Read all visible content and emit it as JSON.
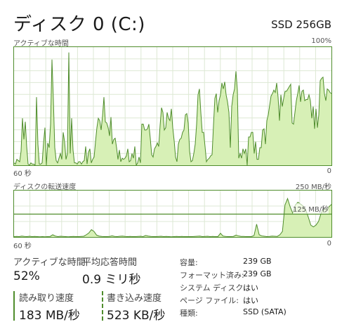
{
  "header": {
    "title": "ディスク 0 (C:)",
    "model": "SSD 256GB"
  },
  "active_chart": {
    "label": "アクティブな時間",
    "max_label": "100%",
    "time_label": "60 秒",
    "min_label": "0"
  },
  "transfer_chart": {
    "label": "ディスクの転送速度",
    "max_label": "250 MB/秒",
    "marker_label": "125 MB/秒",
    "time_label": "60 秒",
    "min_label": "0"
  },
  "stats": {
    "active_time_label": "アクティブな時間",
    "active_time_value": "52%",
    "response_label": "平均応答時間",
    "response_value": "0.9 ミリ秒",
    "read_label": "読み取り速度",
    "read_value": "183 MB/秒",
    "write_label": "書き込み速度",
    "write_value": "523 KB/秒"
  },
  "properties": [
    {
      "key": "容量:",
      "value": "239 GB"
    },
    {
      "key": "フォーマット済み:",
      "value": "239 GB"
    },
    {
      "key": "システム ディスク:",
      "value": "はい"
    },
    {
      "key": "ページ ファイル:",
      "value": "はい"
    },
    {
      "key": "種類:",
      "value": "SSD (SATA)"
    }
  ],
  "colors": {
    "accent": "#4f8d2c",
    "fill": "#d7f0b6",
    "grid": "#dde8d4"
  },
  "chart_data": [
    {
      "type": "area",
      "title": "アクティブな時間",
      "x_label": "60 秒",
      "ylim": [
        0,
        100
      ],
      "unit": "%",
      "grid": true,
      "values": [
        2,
        1,
        5,
        4,
        3,
        12,
        40,
        22,
        37,
        16,
        1,
        0,
        2,
        1,
        1,
        0,
        58,
        18,
        1,
        1,
        2,
        19,
        32,
        0,
        19,
        15,
        35,
        90,
        56,
        15,
        4,
        2,
        6,
        10,
        5,
        28,
        20,
        5,
        10,
        96,
        10,
        40,
        13,
        2,
        2,
        1,
        3,
        3,
        1,
        3,
        4,
        16,
        1,
        11,
        14,
        2,
        5,
        7,
        20,
        32,
        40,
        38,
        30,
        42,
        58,
        37,
        36,
        32,
        25,
        41,
        18,
        22,
        23,
        15,
        5,
        13,
        3,
        6,
        5,
        6,
        8,
        14,
        3,
        4,
        10,
        6,
        16,
        0,
        2,
        7,
        2,
        35,
        35,
        30,
        30,
        31,
        35,
        23,
        9,
        7,
        14,
        16,
        19,
        16,
        34,
        49,
        45,
        30,
        32,
        45,
        40,
        38,
        48,
        32,
        21,
        7,
        3,
        18,
        22,
        23,
        28,
        30,
        43,
        44,
        36,
        12,
        3,
        4,
        10,
        18,
        35,
        60,
        65,
        45,
        28,
        28,
        16,
        3,
        5,
        6,
        8,
        9,
        34,
        57,
        61,
        45,
        55,
        60,
        70,
        65,
        71,
        60,
        54,
        45,
        15,
        50,
        60,
        65,
        80,
        64,
        6,
        10,
        6,
        14,
        10,
        14,
        0,
        24,
        24,
        28,
        28,
        10,
        20,
        5,
        5,
        15,
        15,
        30,
        31,
        18,
        38,
        43,
        51,
        59,
        61,
        64,
        62,
        70,
        58,
        38,
        60,
        50,
        57,
        63,
        63,
        65,
        67,
        69,
        36,
        35,
        45,
        55,
        61,
        68,
        54,
        63,
        64,
        55,
        56,
        56,
        60,
        55,
        40,
        50,
        31,
        48,
        32,
        43,
        72,
        74,
        75,
        61,
        55,
        65,
        64,
        62,
        61
      ]
    },
    {
      "type": "area",
      "title": "ディスクの転送速度",
      "x_label": "60 秒",
      "ylim": [
        0,
        250
      ],
      "unit": "MB/秒",
      "grid": true,
      "values": [
        2,
        3,
        2,
        5,
        3,
        2,
        4,
        2,
        3,
        2,
        1,
        2,
        1,
        2,
        3,
        12,
        5,
        2,
        4,
        3,
        2,
        1,
        2,
        3,
        2,
        2,
        3,
        4,
        12,
        22,
        40,
        30,
        10,
        5,
        3,
        2,
        2,
        3,
        6,
        3,
        2,
        4,
        5,
        3,
        2,
        3,
        2,
        2,
        3,
        4,
        2,
        8,
        5,
        3,
        2,
        2,
        3,
        4,
        2,
        3,
        2,
        1,
        2,
        3,
        2,
        3,
        2,
        2,
        2,
        2,
        3,
        4,
        5,
        2,
        3,
        4,
        2,
        3,
        2,
        2,
        20,
        5,
        3,
        2,
        2,
        3,
        10,
        6,
        3,
        3,
        2,
        2,
        2,
        8,
        70,
        12,
        6,
        4,
        2,
        3,
        5,
        4,
        3,
        12,
        30,
        175,
        210,
        165,
        130,
        175,
        190,
        180,
        170,
        150,
        110,
        65,
        55,
        65,
        85,
        130,
        155,
        150,
        165,
        178
      ]
    }
  ]
}
